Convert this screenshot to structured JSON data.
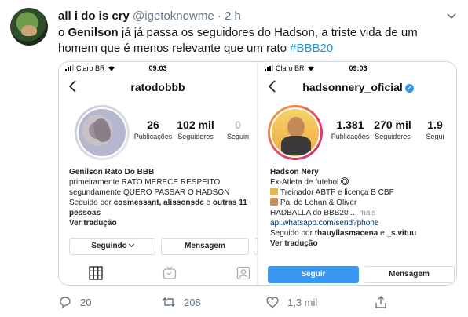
{
  "tweet": {
    "display_name": "all i do is cry",
    "handle": "@igetoknowme",
    "separator": "·",
    "time": "2 h",
    "text_prefix": "o ",
    "text_bold": "Genilson",
    "text_rest": " já já passa os seguidores do Hadson, a triste vida de um homem que é menos relevante que um rato ",
    "hashtag": "#BBB20"
  },
  "left_profile": {
    "carrier": "Claro BR",
    "clock": "09:03",
    "username": "ratodobbb",
    "stats": [
      {
        "num": "26",
        "label": "Publicações"
      },
      {
        "num": "102 mil",
        "label": "Seguidores"
      },
      {
        "num": "0",
        "label": "Seguin"
      }
    ],
    "bio_name": "Genilson Rato Do BBB",
    "bio_lines": [
      "primeiramente RATO MERECE RESPEITO",
      "segundamente QUERO PASSAR O HADSON"
    ],
    "followed_prefix": "Seguido por ",
    "followed_names": "cosmessant, alissonsdc",
    "followed_mid": " e ",
    "followed_others": "outras 11",
    "followed_tail": "pessoas",
    "translate": "Ver tradução",
    "btn_following": "Seguindo",
    "btn_message": "Mensagem"
  },
  "right_profile": {
    "carrier": "Claro BR",
    "clock": "09:03",
    "username": "hadsonnery_oficial",
    "stats": [
      {
        "num": "1.381",
        "label": "Publicações"
      },
      {
        "num": "270 mil",
        "label": "Seguidores"
      },
      {
        "num": "1.9",
        "label": "Segui"
      }
    ],
    "bio_name": "Hadson Nery",
    "bio_line1": "Ex-Atleta de futebol",
    "bio_line2": "Treinador ABTF e licença B CBF",
    "bio_line3": "Pai do Lohan & Oliver",
    "bio_line4": "HADBALLA do BBB20 ...",
    "more": " mais",
    "link": "api.whatsapp.com/send?phone",
    "followed_prefix": "Seguido por ",
    "followed_names": "thauyllasmacena",
    "followed_mid": " e ",
    "followed_other": "_s.vituu",
    "translate": "Ver tradução",
    "btn_follow": "Seguir",
    "btn_message": "Mensagem"
  },
  "actions": {
    "replies": "20",
    "retweets": "208",
    "likes": "1,3 mil"
  },
  "colors": {
    "twitter_blue": "#1b95e0",
    "instagram_blue": "#3897f0",
    "muted": "#657786"
  }
}
